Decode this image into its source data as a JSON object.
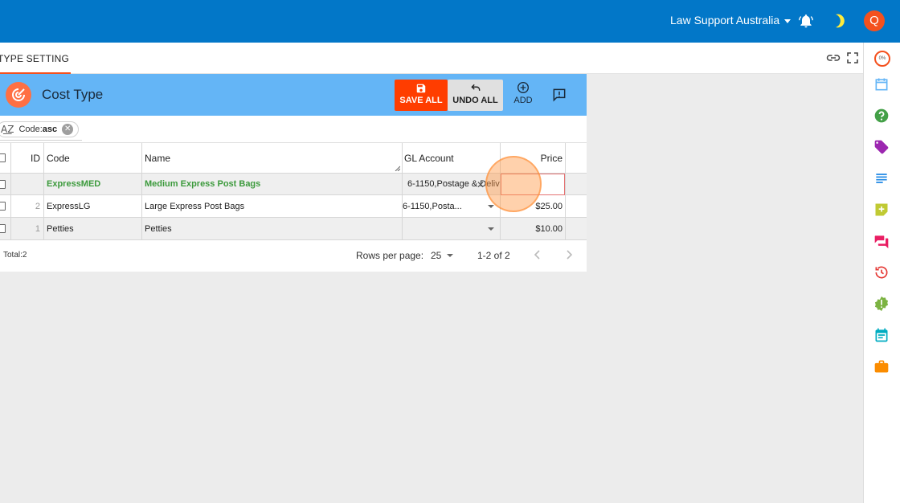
{
  "header": {
    "org_name": "Law Support Australia",
    "avatar_initial": "Q"
  },
  "tabs": [
    {
      "label": "TYPE SETTING",
      "active": true
    }
  ],
  "rail": {
    "progress_text": "0%"
  },
  "panel": {
    "title": "Cost Type",
    "actions": {
      "save_all": "SAVE ALL",
      "undo_all": "UNDO ALL",
      "add": "ADD"
    }
  },
  "sort_chip": {
    "key": "Code:",
    "value": "asc"
  },
  "table": {
    "columns": [
      "ID",
      "Code",
      "Name",
      "GL Account",
      "Price"
    ],
    "rows": [
      {
        "id": "",
        "code": "ExpressMED",
        "name": "Medium Express Post Bags",
        "gl_account": "6-1150,Postage & Deliv",
        "price": "",
        "editing": true
      },
      {
        "id": "2",
        "code": "ExpressLG",
        "name": "Large Express Post Bags",
        "gl_account": "6-1150,Posta...",
        "price": "$25.00"
      },
      {
        "id": "1",
        "code": "Petties",
        "name": "Petties",
        "gl_account": "",
        "price": "$10.00"
      }
    ]
  },
  "footer": {
    "total": "Total:2",
    "rows_per_page_label": "Rows per page:",
    "rows_per_page": "25",
    "range": "1-2 of 2"
  },
  "colors": {
    "topbar": "#0277c8",
    "panel_header": "#64b5f6",
    "accent": "#f4511e",
    "save_button": "#ff3d00",
    "new_row_text": "#3c9a3c"
  }
}
